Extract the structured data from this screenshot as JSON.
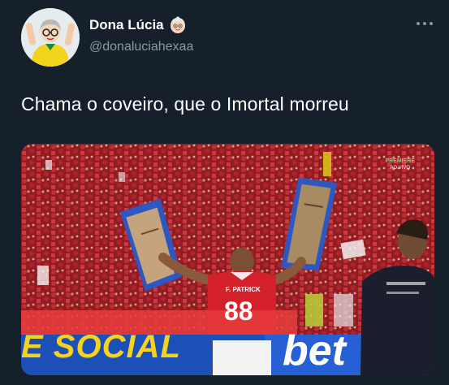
{
  "author": {
    "display_name": "Dona Lúcia",
    "name_emoji": "older-woman-emoji",
    "handle": "@donaluciahexaa",
    "avatar": "avatar-woman-yellow-jersey"
  },
  "tweet": {
    "text": "Chama o coveiro, que o Imortal morreu",
    "more_icon": "more-options-icon"
  },
  "media": {
    "description_icon": "photo",
    "banner_text": "E SOCIAL",
    "broadcaster": "PREMIERE",
    "broadcaster_status": "AO VIVO",
    "jersey_name": "F. PATRICK",
    "jersey_number": "88",
    "sponsor_text": "bet"
  },
  "colors": {
    "background": "#15202b",
    "text_primary": "#ffffff",
    "text_secondary": "#8899a6",
    "jersey_red": "#d3202a",
    "banner_yellow": "#f6d31a",
    "banner_blue": "#1d4fb8"
  }
}
